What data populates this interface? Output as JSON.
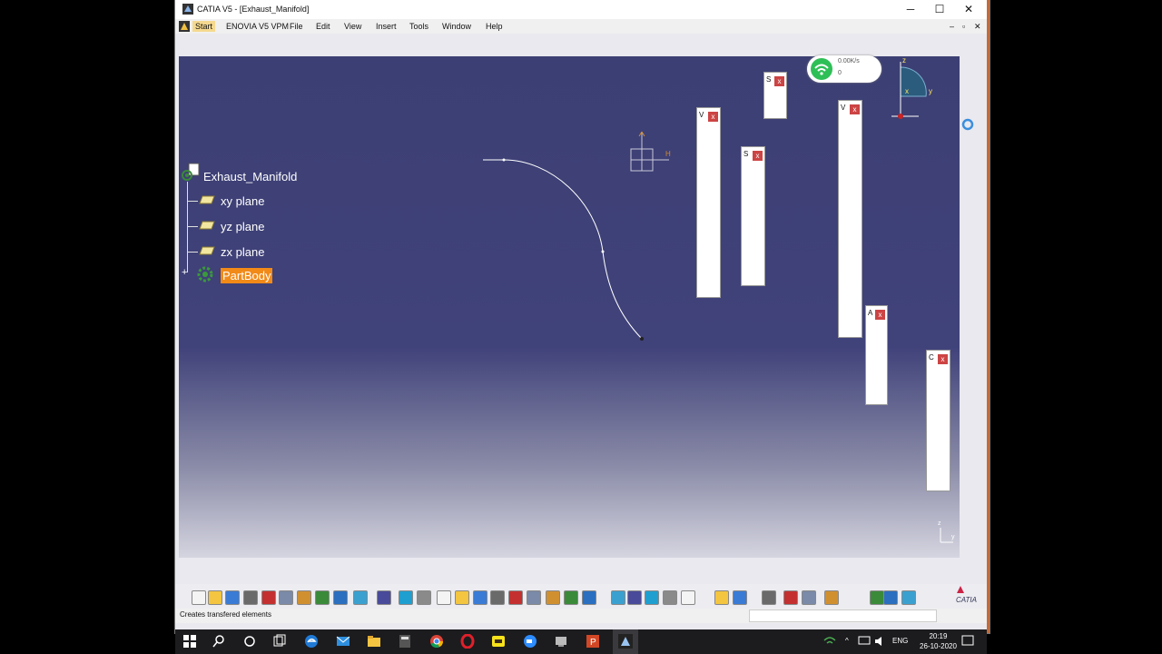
{
  "window": {
    "title": "CATIA V5 - [Exhaust_Manifold]",
    "minimize": "─",
    "maximize": "☐",
    "close": "✕"
  },
  "menu": {
    "items": [
      "Start",
      "ENOVIA V5 VPM",
      "File",
      "Edit",
      "View",
      "Insert",
      "Tools",
      "Window",
      "Help"
    ],
    "mdi_controls": [
      "–",
      "▫",
      "✕"
    ]
  },
  "tree": {
    "root": "Exhaust_Manifold",
    "children": [
      "xy plane",
      "yz plane",
      "zx plane",
      "PartBody"
    ]
  },
  "sketch_axis": {
    "h_label": "H",
    "v_label": "V"
  },
  "panels": [
    {
      "label": "S",
      "close": "x"
    },
    {
      "label": "V",
      "close": "x"
    },
    {
      "label": "S",
      "close": "x"
    },
    {
      "label": "V",
      "close": "x"
    },
    {
      "label": "A",
      "close": "x"
    },
    {
      "label": "C",
      "close": "x"
    }
  ],
  "network_widget": {
    "speed": "0.00K/s",
    "count": "0"
  },
  "compass": {
    "z": "z",
    "x": "x",
    "y": "y"
  },
  "corner_axis": {
    "z": "z",
    "y": "y"
  },
  "status": {
    "message": "Creates transfered elements"
  },
  "brand": "CATIA",
  "taskbar": {
    "lang": "ENG",
    "time": "20:19",
    "date": "26-10-2020"
  },
  "colors": {
    "viewport_top": "#3c3f73",
    "partbody_highlight": "#f28a18",
    "close_red": "#cc4444",
    "wifi_green": "#2fbf57"
  }
}
